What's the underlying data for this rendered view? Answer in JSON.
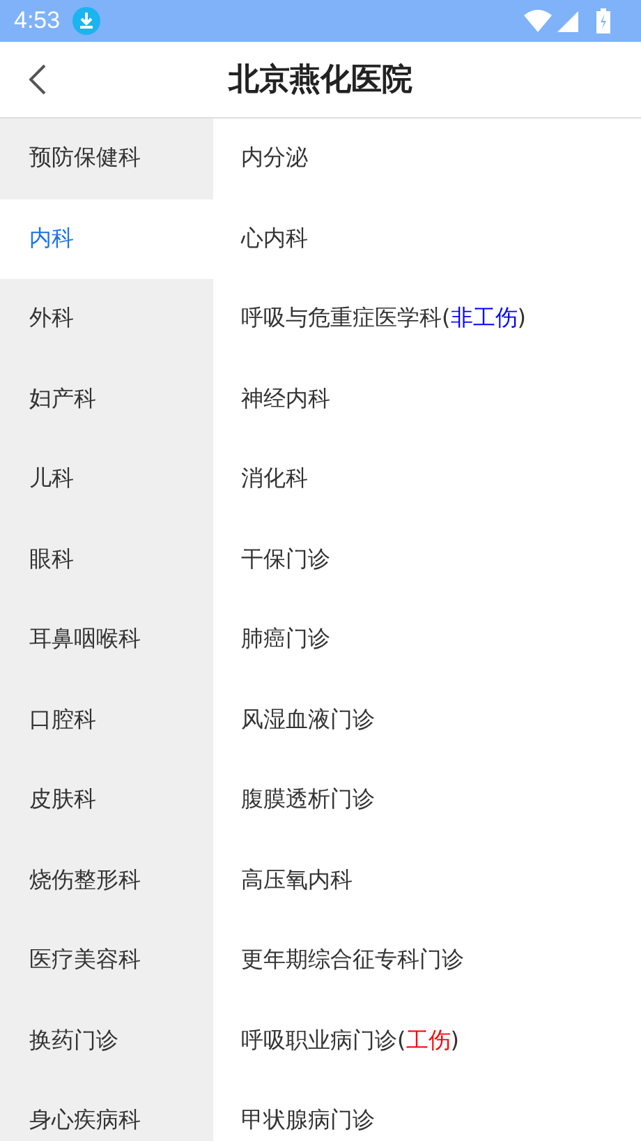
{
  "status_bar": {
    "time": "4:53"
  },
  "header": {
    "title": "北京燕化医院"
  },
  "departments": [
    {
      "label": "预防保健科",
      "selected": false
    },
    {
      "label": "内科",
      "selected": true
    },
    {
      "label": "外科",
      "selected": false
    },
    {
      "label": "妇产科",
      "selected": false
    },
    {
      "label": "儿科",
      "selected": false
    },
    {
      "label": "眼科",
      "selected": false
    },
    {
      "label": "耳鼻咽喉科",
      "selected": false
    },
    {
      "label": "口腔科",
      "selected": false
    },
    {
      "label": "皮肤科",
      "selected": false
    },
    {
      "label": "烧伤整形科",
      "selected": false
    },
    {
      "label": "医疗美容科",
      "selected": false
    },
    {
      "label": "换药门诊",
      "selected": false
    },
    {
      "label": "身心疾病科",
      "selected": false
    }
  ],
  "clinics": [
    {
      "label": "内分泌"
    },
    {
      "label": "心内科"
    },
    {
      "label": "呼吸与危重症医学科(",
      "tag": {
        "text": "非工伤",
        "color": "#0000ff"
      },
      "suffix": ")"
    },
    {
      "label": "神经内科"
    },
    {
      "label": "消化科"
    },
    {
      "label": "干保门诊"
    },
    {
      "label": "肺癌门诊"
    },
    {
      "label": "风湿血液门诊"
    },
    {
      "label": "腹膜透析门诊"
    },
    {
      "label": "高压氧内科"
    },
    {
      "label": "更年期综合征专科门诊"
    },
    {
      "label": "呼吸职业病门诊(",
      "tag": {
        "text": "工伤",
        "color": "#ff0000"
      },
      "suffix": ")"
    },
    {
      "label": "甲状腺病门诊"
    }
  ]
}
